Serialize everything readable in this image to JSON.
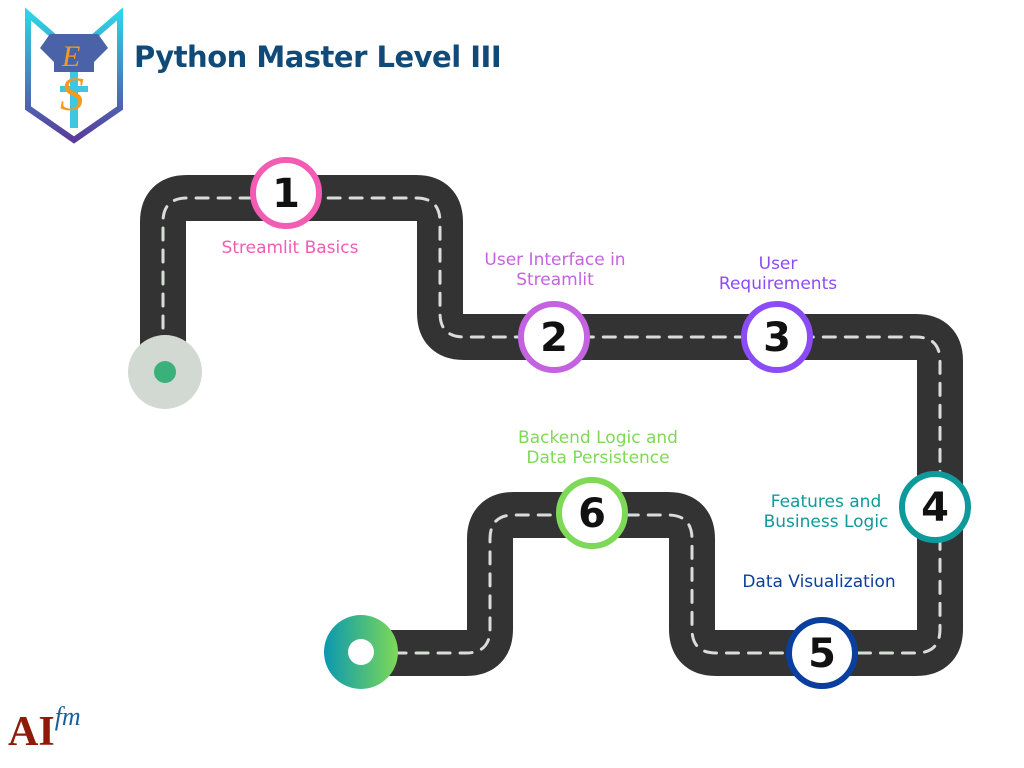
{
  "header": {
    "title": "Python Master Level III",
    "logo_icon": "shield-sword-logo"
  },
  "roadmap": {
    "steps": [
      {
        "number": "1",
        "label": "Streamlit Basics",
        "color": "#f25cb4"
      },
      {
        "number": "2",
        "label_lines": [
          "User Interface in",
          "Streamlit"
        ],
        "color": "#c463e0"
      },
      {
        "number": "3",
        "label_lines": [
          "User",
          "Requirements"
        ],
        "color": "#8c4cf5"
      },
      {
        "number": "4",
        "label_lines": [
          "Features and",
          "Business Logic"
        ],
        "color": "#0e9a9a"
      },
      {
        "number": "5",
        "label": "Data Visualization",
        "color": "#0b3f9e"
      },
      {
        "number": "6",
        "label_lines": [
          "Backend Logic and",
          "Data Persistence"
        ],
        "color": "#7ed957"
      }
    ],
    "road_color": "#333333"
  },
  "footer": {
    "brand_main": "AI",
    "brand_sup": "fm"
  }
}
